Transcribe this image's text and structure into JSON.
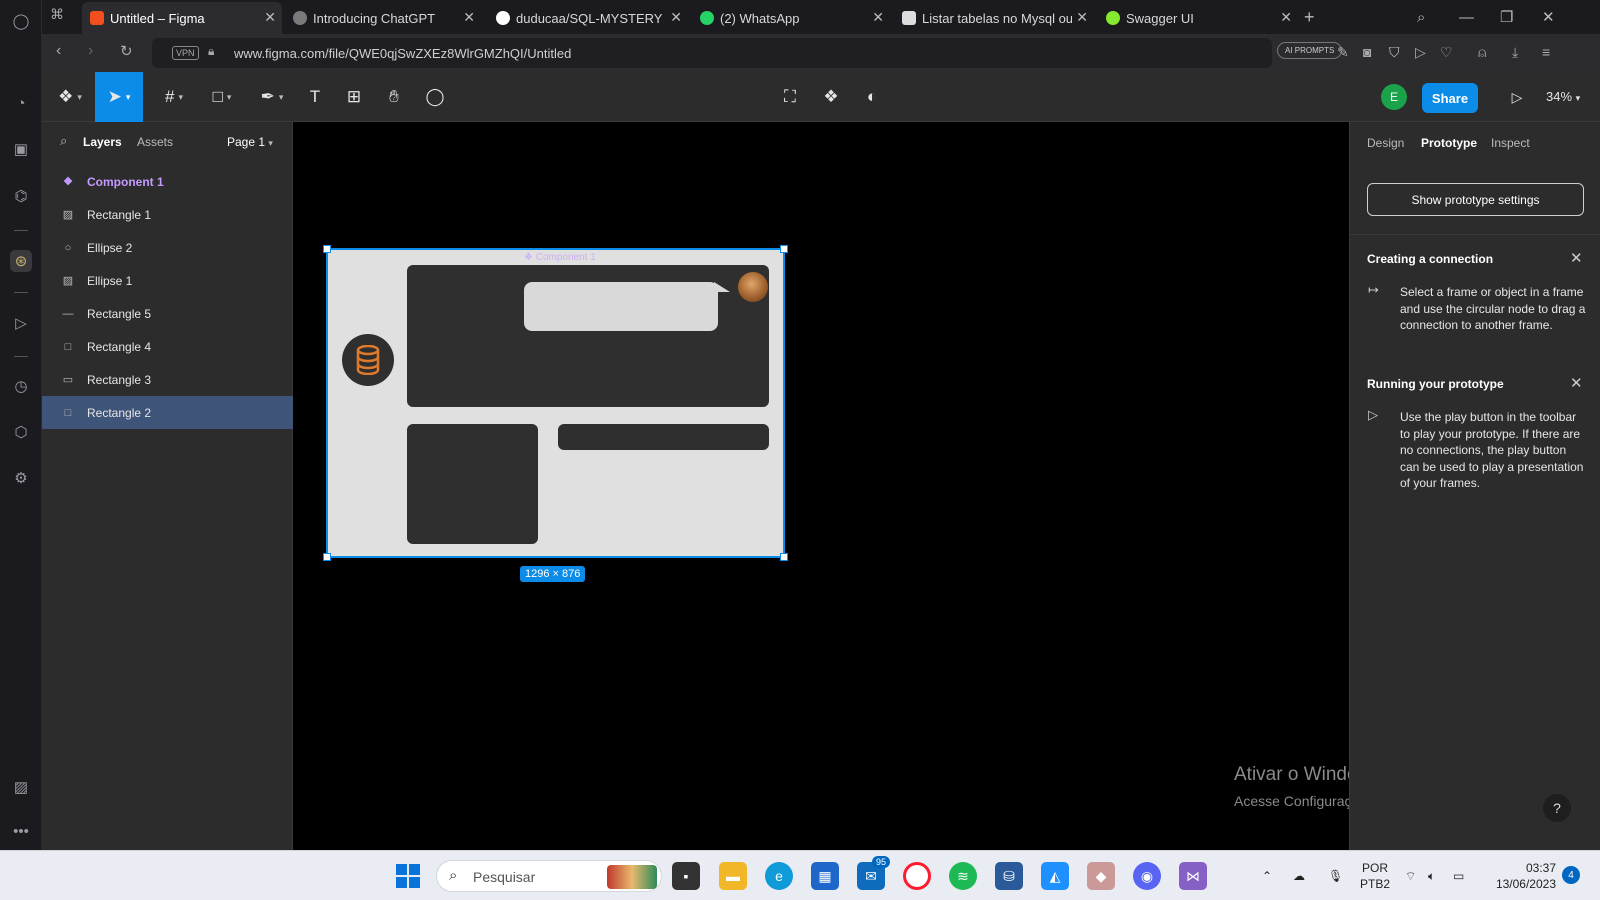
{
  "browser": {
    "tabs": [
      {
        "title": "Untitled – Figma",
        "active": true,
        "favicon_color": "#f24e1e"
      },
      {
        "title": "Introducing ChatGPT",
        "active": false,
        "favicon_color": "#7a7a7a"
      },
      {
        "title": "duducaa/SQL-MYSTERY at",
        "active": false,
        "favicon_color": "#ffffff"
      },
      {
        "title": "(2) WhatsApp",
        "active": false,
        "favicon_color": "#25d366"
      },
      {
        "title": "Listar tabelas no Mysql ou",
        "active": false,
        "favicon_color": "#dddddd"
      },
      {
        "title": "Swagger UI",
        "active": false,
        "favicon_color": "#85ea2d"
      }
    ],
    "vpn_label": "VPN",
    "url": "www.figma.com/file/QWE0qjSwZXEz8WlrGMZhQI/Untitled",
    "ai_prompts_label": "AI PROMPTS"
  },
  "figma_toolbar": {
    "share_label": "Share",
    "avatar_initial": "E",
    "zoom": "34%"
  },
  "left_panel": {
    "tab_layers": "Layers",
    "tab_assets": "Assets",
    "page_label": "Page 1",
    "layers": [
      {
        "name": "Component 1",
        "icon": "component-icon",
        "type": "component"
      },
      {
        "name": "Rectangle 1",
        "icon": "image-icon",
        "type": "normal"
      },
      {
        "name": "Ellipse 2",
        "icon": "ellipse-icon",
        "type": "normal"
      },
      {
        "name": "Ellipse 1",
        "icon": "image-icon",
        "type": "normal"
      },
      {
        "name": "Rectangle 5",
        "icon": "line-icon",
        "type": "normal"
      },
      {
        "name": "Rectangle 4",
        "icon": "rectangle-icon",
        "type": "normal"
      },
      {
        "name": "Rectangle 3",
        "icon": "thin-rectangle-icon",
        "type": "normal"
      },
      {
        "name": "Rectangle 2",
        "icon": "rectangle-icon",
        "type": "selected"
      }
    ]
  },
  "canvas": {
    "component_label": "Component 1",
    "dimension_tag": "1296 × 876",
    "watermark_title": "Ativar o Windows",
    "watermark_subtitle": "Acesse Configurações para ativar o Windows."
  },
  "right_panel": {
    "tabs": [
      "Design",
      "Prototype",
      "Inspect"
    ],
    "active_tab": "Prototype",
    "prototype_settings_label": "Show prototype settings",
    "sections": [
      {
        "title": "Creating a connection",
        "icon": "connection-icon",
        "text": "Select a frame or object in a frame and use the circular node to drag a connection to another frame."
      },
      {
        "title": "Running your prototype",
        "icon": "play-icon",
        "text": "Use the play button in the toolbar to play your prototype. If there are no connections, the play button can be used to play a presentation of your frames."
      }
    ],
    "help_label": "?"
  },
  "taskbar": {
    "search_placeholder": "Pesquisar",
    "mail_badge": "95",
    "lang_line1": "POR",
    "lang_line2": "PTB2",
    "time": "03:37",
    "date": "13/06/2023",
    "notification_count": "4"
  },
  "colors": {
    "accent": "#0c8ce9",
    "component": "#c49bff",
    "selected_layer": "#3f5479"
  }
}
